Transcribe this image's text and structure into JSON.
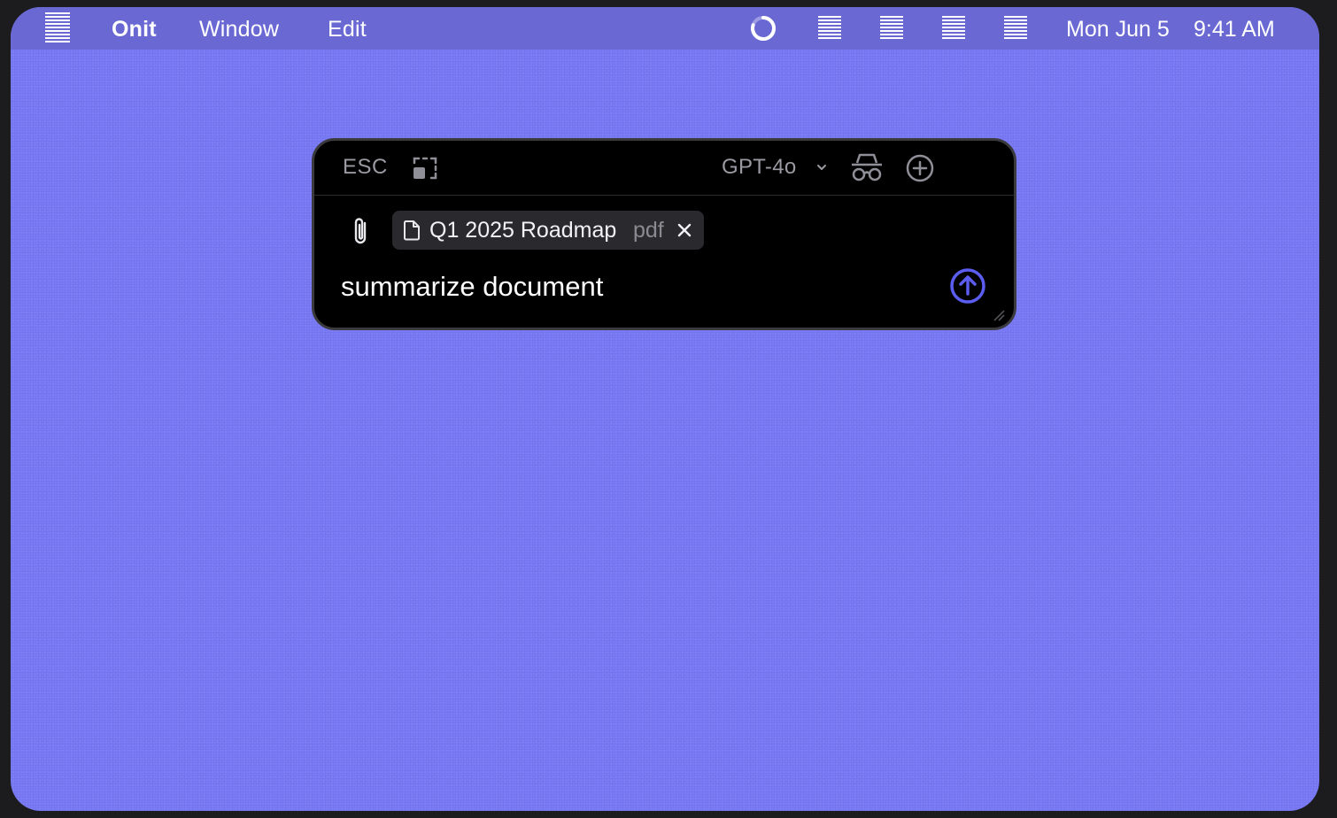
{
  "menubar": {
    "app_name": "Onit",
    "menus": [
      "Window",
      "Edit"
    ],
    "date": "Mon Jun 5",
    "time": "9:41 AM",
    "status_icons": [
      "loading-spinner-icon",
      "status-item-icon",
      "status-item-icon",
      "status-item-icon",
      "status-item-icon"
    ]
  },
  "panel": {
    "esc_label": "ESC",
    "model": "GPT-4o",
    "attachment": {
      "name": "Q1 2025 Roadmap",
      "extension": "pdf"
    },
    "prompt": "summarize document"
  },
  "colors": {
    "desktop": "#7b7cf4",
    "menubar": "#6a69d4",
    "panel": "#000000",
    "accent": "#5b5cf0"
  }
}
